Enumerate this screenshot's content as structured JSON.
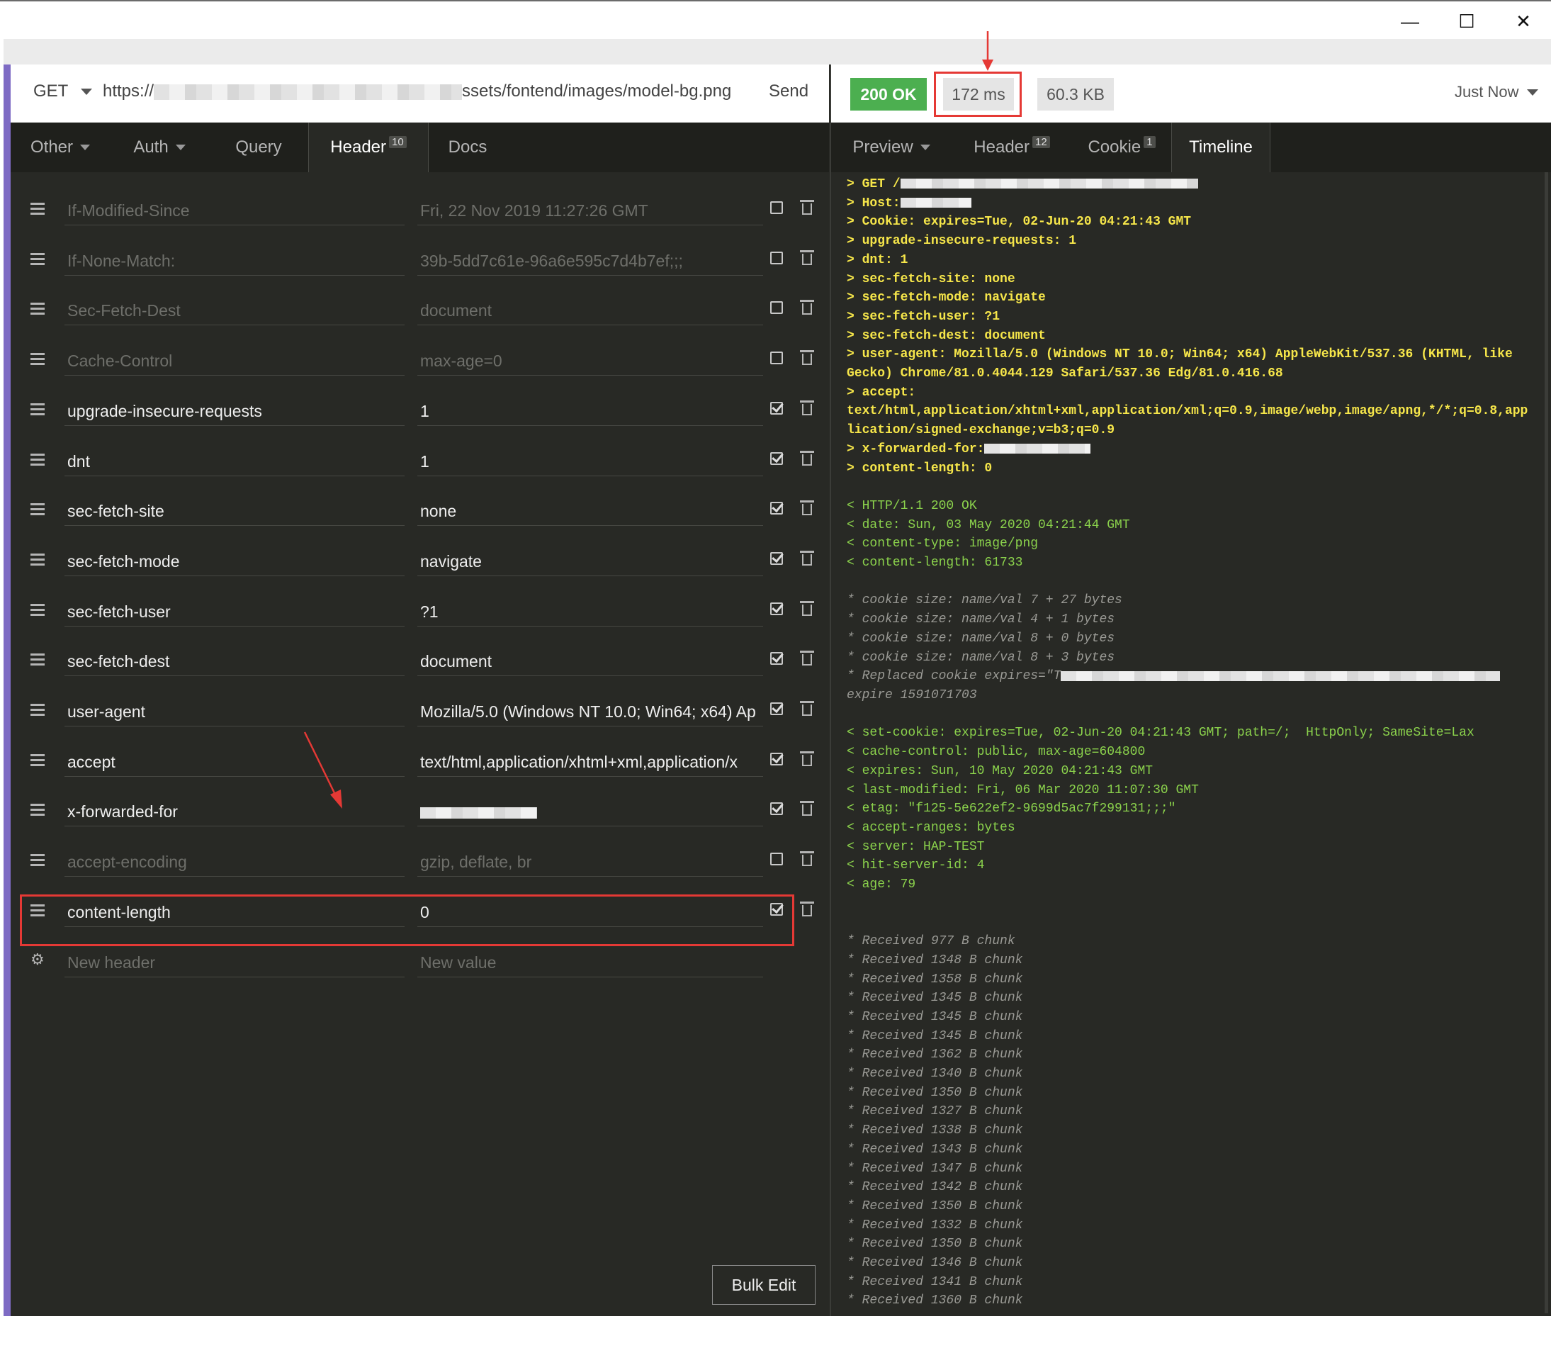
{
  "window": {
    "min": "—",
    "max": "☐",
    "close": "✕"
  },
  "request": {
    "method": "GET",
    "url_prefix": "https://",
    "url_suffix": "ssets/fontend/images/model-bg.png",
    "send": "Send"
  },
  "response": {
    "status": "200 OK",
    "time": "172 ms",
    "size": "60.3 KB",
    "when": "Just Now"
  },
  "left_tabs": [
    {
      "label": "Other",
      "count": ""
    },
    {
      "label": "Auth",
      "count": ""
    },
    {
      "label": "Query",
      "count": ""
    },
    {
      "label": "Header",
      "count": "10"
    },
    {
      "label": "Docs",
      "count": ""
    }
  ],
  "right_tabs": [
    {
      "label": "Preview",
      "count": ""
    },
    {
      "label": "Header",
      "count": "12"
    },
    {
      "label": "Cookie",
      "count": "1"
    },
    {
      "label": "Timeline",
      "count": ""
    }
  ],
  "headers": [
    {
      "name": "If-Modified-Since",
      "value": "Fri, 22 Nov 2019 11:27:26 GMT",
      "enabled": false
    },
    {
      "name": "If-None-Match:",
      "value": "39b-5dd7c61e-96a6e595c7d4b7ef;;;",
      "enabled": false
    },
    {
      "name": "Sec-Fetch-Dest",
      "value": "document",
      "enabled": false
    },
    {
      "name": "Cache-Control",
      "value": "max-age=0",
      "enabled": false
    },
    {
      "name": "upgrade-insecure-requests",
      "value": "1",
      "enabled": true
    },
    {
      "name": "dnt",
      "value": "1",
      "enabled": true
    },
    {
      "name": "sec-fetch-site",
      "value": "none",
      "enabled": true
    },
    {
      "name": "sec-fetch-mode",
      "value": "navigate",
      "enabled": true
    },
    {
      "name": "sec-fetch-user",
      "value": "?1",
      "enabled": true
    },
    {
      "name": "sec-fetch-dest",
      "value": "document",
      "enabled": true
    },
    {
      "name": "user-agent",
      "value": "Mozilla/5.0 (Windows NT 10.0; Win64; x64) Ap",
      "enabled": true
    },
    {
      "name": "accept",
      "value": "text/html,application/xhtml+xml,application/x",
      "enabled": true
    },
    {
      "name": "x-forwarded-for",
      "value": "",
      "enabled": true
    },
    {
      "name": "accept-encoding",
      "value": "gzip, deflate, br",
      "enabled": false
    },
    {
      "name": "content-length",
      "value": "0",
      "enabled": true
    }
  ],
  "new_header": {
    "name_placeholder": "New header",
    "value_placeholder": "New value"
  },
  "bulk_edit": "Bulk Edit",
  "timeline": [
    {
      "kind": "req",
      "text": "> GET /"
    },
    {
      "kind": "req",
      "text": "> Host:"
    },
    {
      "kind": "req",
      "text": "> Cookie: expires=Tue, 02-Jun-20 04:21:43 GMT"
    },
    {
      "kind": "req",
      "text": "> upgrade-insecure-requests: 1"
    },
    {
      "kind": "req",
      "text": "> dnt: 1"
    },
    {
      "kind": "req",
      "text": "> sec-fetch-site: none"
    },
    {
      "kind": "req",
      "text": "> sec-fetch-mode: navigate"
    },
    {
      "kind": "req",
      "text": "> sec-fetch-user: ?1"
    },
    {
      "kind": "req",
      "text": "> sec-fetch-dest: document"
    },
    {
      "kind": "req",
      "text": "> user-agent: Mozilla/5.0 (Windows NT 10.0; Win64; x64) AppleWebKit/537.36 (KHTML, like"
    },
    {
      "kind": "req",
      "text": "Gecko) Chrome/81.0.4044.129 Safari/537.36 Edg/81.0.416.68"
    },
    {
      "kind": "req",
      "text": "> accept:"
    },
    {
      "kind": "req",
      "text": "text/html,application/xhtml+xml,application/xml;q=0.9,image/webp,image/apng,*/*;q=0.8,app"
    },
    {
      "kind": "req",
      "text": "lication/signed-exchange;v=b3;q=0.9"
    },
    {
      "kind": "req",
      "text": "> x-forwarded-for:"
    },
    {
      "kind": "req",
      "text": "> content-length: 0"
    },
    {
      "kind": "blank",
      "text": ""
    },
    {
      "kind": "res",
      "text": "< HTTP/1.1 200 OK"
    },
    {
      "kind": "res",
      "text": "< date: Sun, 03 May 2020 04:21:44 GMT"
    },
    {
      "kind": "res",
      "text": "< content-type: image/png"
    },
    {
      "kind": "res",
      "text": "< content-length: 61733"
    },
    {
      "kind": "blank",
      "text": ""
    },
    {
      "kind": "info",
      "text": "* cookie size: name/val 7 + 27 bytes"
    },
    {
      "kind": "info",
      "text": "* cookie size: name/val 4 + 1 bytes"
    },
    {
      "kind": "info",
      "text": "* cookie size: name/val 8 + 0 bytes"
    },
    {
      "kind": "info",
      "text": "* cookie size: name/val 8 + 3 bytes"
    },
    {
      "kind": "info",
      "text": "* Replaced cookie expires=\"T"
    },
    {
      "kind": "info",
      "text": "expire 1591071703"
    },
    {
      "kind": "blank",
      "text": ""
    },
    {
      "kind": "res",
      "text": "< set-cookie: expires=Tue, 02-Jun-20 04:21:43 GMT; path=/;  HttpOnly; SameSite=Lax"
    },
    {
      "kind": "res",
      "text": "< cache-control: public, max-age=604800"
    },
    {
      "kind": "res",
      "text": "< expires: Sun, 10 May 2020 04:21:43 GMT"
    },
    {
      "kind": "res",
      "text": "< last-modified: Fri, 06 Mar 2020 11:07:30 GMT"
    },
    {
      "kind": "res",
      "text": "< etag: \"f125-5e622ef2-9699d5ac7f299131;;;\""
    },
    {
      "kind": "res",
      "text": "< accept-ranges: bytes"
    },
    {
      "kind": "res",
      "text": "< server: HAP-TEST"
    },
    {
      "kind": "res",
      "text": "< hit-server-id: 4"
    },
    {
      "kind": "res",
      "text": "< age: 79"
    },
    {
      "kind": "blank",
      "text": ""
    },
    {
      "kind": "blank",
      "text": ""
    },
    {
      "kind": "info",
      "text": "* Received 977 B chunk"
    },
    {
      "kind": "info",
      "text": "* Received 1348 B chunk"
    },
    {
      "kind": "info",
      "text": "* Received 1358 B chunk"
    },
    {
      "kind": "info",
      "text": "* Received 1345 B chunk"
    },
    {
      "kind": "info",
      "text": "* Received 1345 B chunk"
    },
    {
      "kind": "info",
      "text": "* Received 1345 B chunk"
    },
    {
      "kind": "info",
      "text": "* Received 1362 B chunk"
    },
    {
      "kind": "info",
      "text": "* Received 1340 B chunk"
    },
    {
      "kind": "info",
      "text": "* Received 1350 B chunk"
    },
    {
      "kind": "info",
      "text": "* Received 1327 B chunk"
    },
    {
      "kind": "info",
      "text": "* Received 1338 B chunk"
    },
    {
      "kind": "info",
      "text": "* Received 1343 B chunk"
    },
    {
      "kind": "info",
      "text": "* Received 1347 B chunk"
    },
    {
      "kind": "info",
      "text": "* Received 1342 B chunk"
    },
    {
      "kind": "info",
      "text": "* Received 1350 B chunk"
    },
    {
      "kind": "info",
      "text": "* Received 1332 B chunk"
    },
    {
      "kind": "info",
      "text": "* Received 1350 B chunk"
    },
    {
      "kind": "info",
      "text": "* Received 1346 B chunk"
    },
    {
      "kind": "info",
      "text": "* Received 1341 B chunk"
    },
    {
      "kind": "info",
      "text": "* Received 1360 B chunk"
    }
  ]
}
